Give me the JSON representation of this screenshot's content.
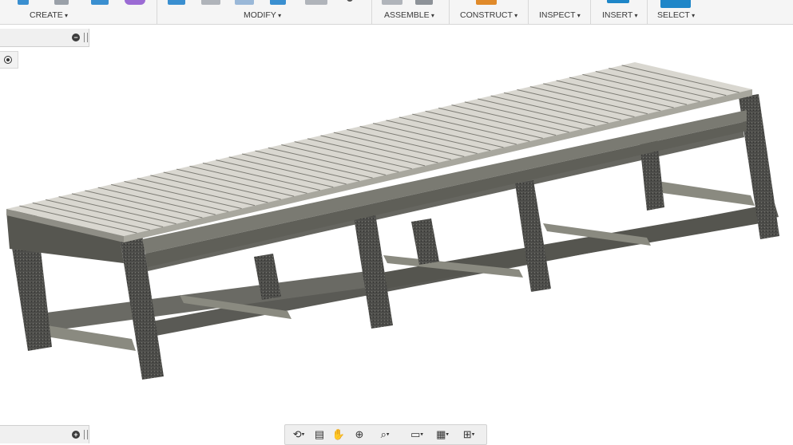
{
  "toolbar": {
    "groups": [
      {
        "label": "CREATE"
      },
      {
        "label": "MODIFY"
      },
      {
        "label": "ASSEMBLE"
      },
      {
        "label": "CONSTRUCT"
      },
      {
        "label": "INSPECT"
      },
      {
        "label": "INSERT"
      },
      {
        "label": "SELECT"
      }
    ]
  },
  "colors": {
    "table_top": "#d9d7d0",
    "frame_dark": "#4a4a4a",
    "frame_mid": "#8a8a80",
    "toolbar_bg": "#f5f5f5",
    "select_accent": "#1e86c8"
  },
  "browser_panel": {
    "collapse_icon": "minus-circle-icon"
  },
  "comments_panel": {
    "expand_icon": "plus-circle-icon"
  },
  "navigation_bar": {
    "tools": [
      "orbit-icon",
      "look-at-icon",
      "pan-icon",
      "zoom-icon",
      "zoom-window-icon",
      "display-settings-icon",
      "grid-icon",
      "viewports-icon"
    ]
  },
  "model": {
    "name": "slatted-bench-frame"
  }
}
